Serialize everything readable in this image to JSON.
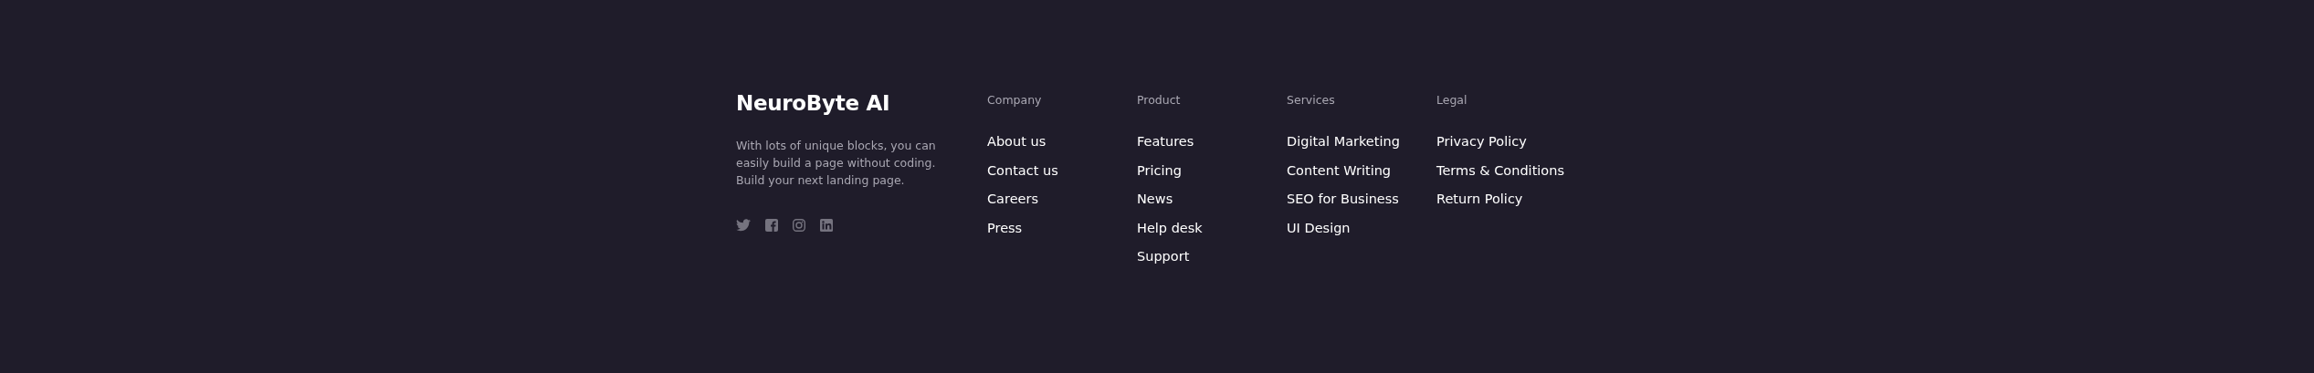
{
  "brand": {
    "name": "NeuroByte AI",
    "description": "With lots of unique blocks, you can easily build a page without coding. Build your next landing page."
  },
  "columns": [
    {
      "heading": "Company",
      "links": [
        "About us",
        "Contact us",
        "Careers",
        "Press"
      ]
    },
    {
      "heading": "Product",
      "links": [
        "Features",
        "Pricing",
        "News",
        "Help desk",
        "Support"
      ]
    },
    {
      "heading": "Services",
      "links": [
        "Digital Marketing",
        "Content Writing",
        "SEO for Business",
        "UI Design"
      ]
    },
    {
      "heading": "Legal",
      "links": [
        "Privacy Policy",
        "Terms & Conditions",
        "Return Policy"
      ]
    }
  ]
}
